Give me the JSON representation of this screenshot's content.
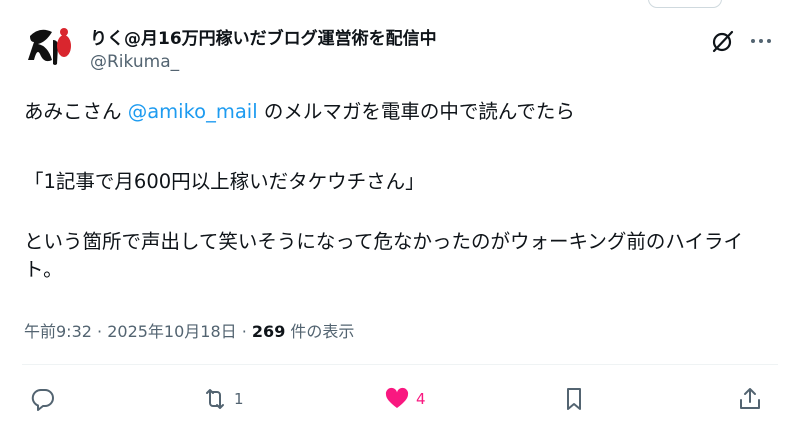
{
  "author": {
    "display_name": "りく@月16万円稼いだブログ運営術を配信中",
    "handle": "@Rikuma_"
  },
  "tweet": {
    "line1_before": "あみこさん ",
    "mention": "@amiko_mail",
    "line1_after": " のメルマガを電車の中で読んでたら",
    "quote_line": "「1記事で月600円以上稼いだタケウチさん」",
    "closing": "という箇所で声出して笑いそうになって危なかったのがウォーキング前のハイライト。"
  },
  "meta": {
    "time": "午前9:32",
    "separator1": " · ",
    "date": "2025年10月18日",
    "separator2": " · ",
    "views_count": "269",
    "views_label": " 件の表示"
  },
  "actions": {
    "reply_count": "",
    "retweet_count": "1",
    "like_count": "4",
    "liked": true
  },
  "colors": {
    "accent": "#1d9bf0",
    "like": "#f91880",
    "secondary_text": "#536471"
  },
  "icons": [
    "grok-icon",
    "more-icon",
    "reply-icon",
    "retweet-icon",
    "heart-icon",
    "bookmark-icon",
    "share-icon"
  ]
}
